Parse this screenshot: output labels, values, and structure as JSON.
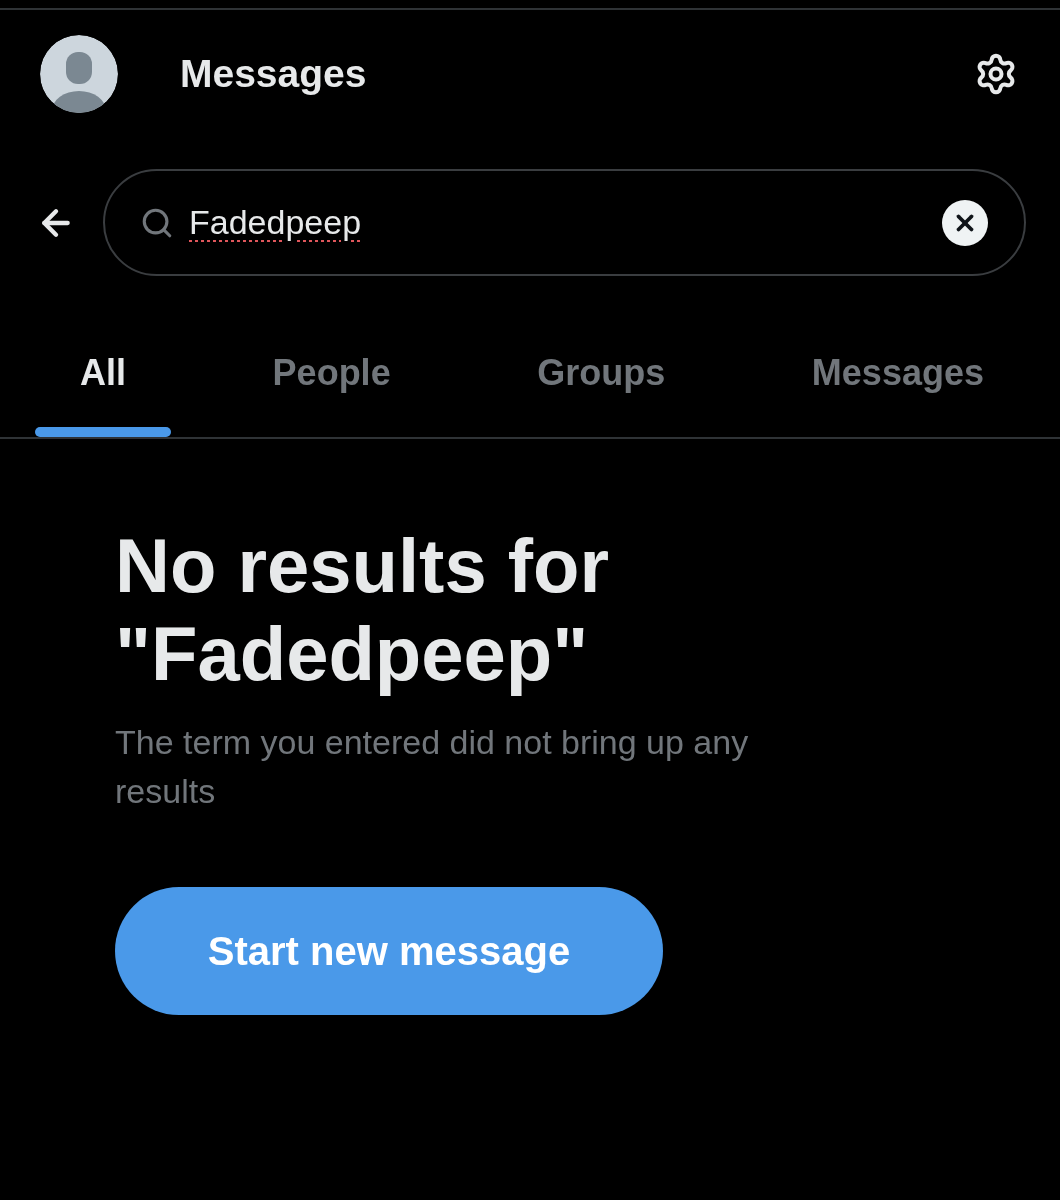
{
  "header": {
    "title": "Messages"
  },
  "search": {
    "value": "Fadedpeep",
    "misspelled": true
  },
  "tabs": [
    {
      "label": "All",
      "selected": true
    },
    {
      "label": "People",
      "selected": false
    },
    {
      "label": "Groups",
      "selected": false
    },
    {
      "label": "Messages",
      "selected": false
    }
  ],
  "empty_state": {
    "title": "No results for \"Fadedpeep\"",
    "message": "The term you entered did not bring up any results",
    "button": "Start new message"
  }
}
